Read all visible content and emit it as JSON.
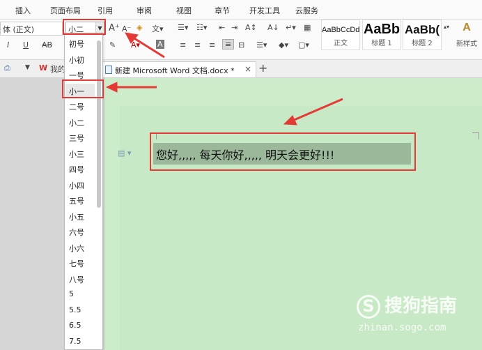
{
  "menu_tabs": [
    "插入",
    "页面布局",
    "引用",
    "审阅",
    "视图",
    "章节",
    "开发工具",
    "云服务"
  ],
  "toolbar": {
    "font_name": "体 (正文)",
    "font_size": "小二",
    "bold_label": "I",
    "underline_label": "U",
    "ab_label": "AB",
    "wps_label": "我的"
  },
  "styles": [
    {
      "sample": "AaBbCcDd",
      "caption": "正文"
    },
    {
      "sample": "AaBb",
      "caption": "标题 1"
    },
    {
      "sample": "AaBb(",
      "caption": "标题 2"
    },
    {
      "sample": "A",
      "caption": "新样式"
    }
  ],
  "doc_tab": {
    "title": "新建 Microsoft Word 文档.docx *",
    "close": "×",
    "new_tab": "+"
  },
  "font_sizes": [
    "初号",
    "小初",
    "一号",
    "小一",
    "二号",
    "小二",
    "三号",
    "小三",
    "四号",
    "小四",
    "五号",
    "小五",
    "六号",
    "小六",
    "七号",
    "八号",
    "5",
    "5.5",
    "6.5",
    "7.5"
  ],
  "selected_size": "小一",
  "document_text": "您好,,,,, 每天你好,,,,, 明天会更好!!!",
  "watermark": {
    "brand": "搜狗指南",
    "logo_letter": "S",
    "url": "zhinan.sogo.com"
  },
  "colors": {
    "accent": "#e53935",
    "doc_bg": "#ccecca",
    "selection": "#9cb89b"
  }
}
